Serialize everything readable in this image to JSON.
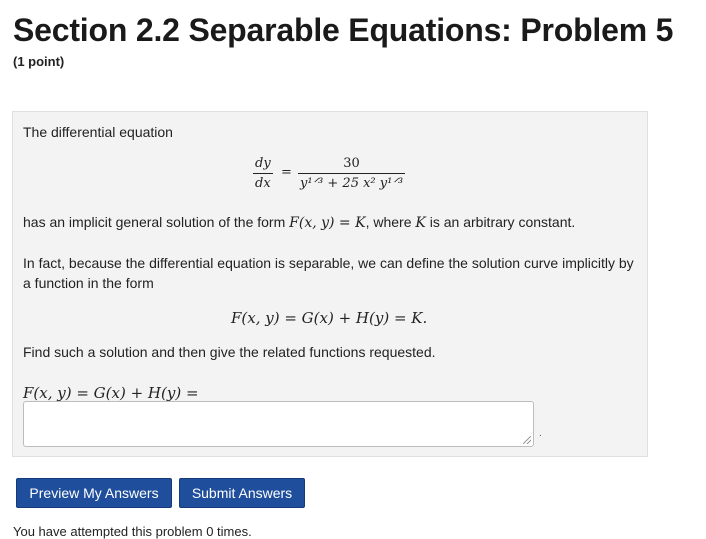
{
  "page": {
    "title": "Section 2.2 Separable Equations: Problem 5",
    "points": "(1 point)"
  },
  "problem": {
    "intro": "The differential equation",
    "eq_lhs_num": "dy",
    "eq_lhs_den": "dx",
    "eq_equals": "=",
    "eq_rhs_num": "30",
    "eq_rhs_den": "y¹ᐟ³ + 25 x² y¹ᐟ³",
    "general_prefix": "has an implicit general solution of the form ",
    "general_math": "F(x, y) = K",
    "general_mid": ", where ",
    "general_k": "K",
    "general_suffix": " is an arbitrary constant.",
    "infact_text": "In fact, because the differential equation is separable, we can define the solution curve implicitly by a function in the form",
    "form_eq": "F(x, y) = G(x) + H(y) = K.",
    "find_text": "Find such a solution and then give the related functions requested.",
    "answer_label": "F(x, y) = G(x) + H(y) =",
    "answer_value": "",
    "answer_dot": "."
  },
  "buttons": {
    "preview": "Preview My Answers",
    "submit": "Submit Answers"
  },
  "footer": {
    "attempts": "You have attempted this problem 0 times."
  }
}
